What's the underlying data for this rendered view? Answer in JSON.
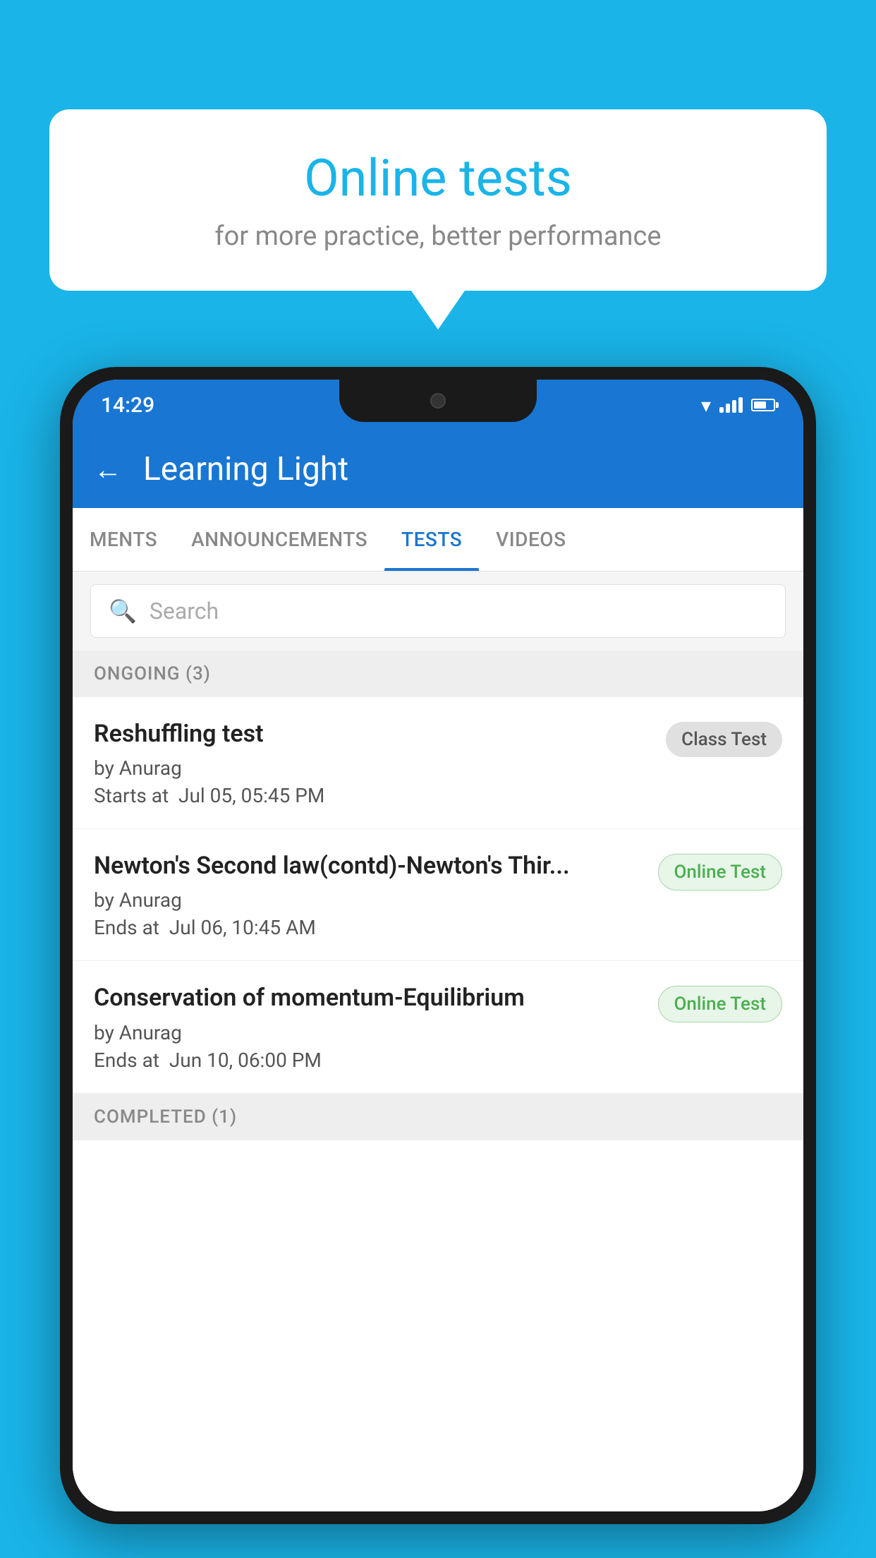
{
  "background_color": "#1ab4e8",
  "speech_bubble": {
    "title": "Online tests",
    "subtitle": "for more practice, better performance"
  },
  "status_bar": {
    "time": "14:29",
    "wifi": "▾",
    "battery_label": "battery"
  },
  "app_bar": {
    "title": "Learning Light",
    "back_icon": "←"
  },
  "tabs": [
    {
      "label": "MENTS",
      "active": false
    },
    {
      "label": "ANNOUNCEMENTS",
      "active": false
    },
    {
      "label": "TESTS",
      "active": true
    },
    {
      "label": "VIDEOS",
      "active": false
    }
  ],
  "search": {
    "placeholder": "Search"
  },
  "ongoing_section": {
    "label": "ONGOING (3)"
  },
  "tests": [
    {
      "name": "Reshuffling test",
      "author": "by Anurag",
      "time_label": "Starts at",
      "time": "Jul 05, 05:45 PM",
      "badge": "Class Test",
      "badge_type": "class"
    },
    {
      "name": "Newton's Second law(contd)-Newton's Thir...",
      "author": "by Anurag",
      "time_label": "Ends at",
      "time": "Jul 06, 10:45 AM",
      "badge": "Online Test",
      "badge_type": "online"
    },
    {
      "name": "Conservation of momentum-Equilibrium",
      "author": "by Anurag",
      "time_label": "Ends at",
      "time": "Jun 10, 06:00 PM",
      "badge": "Online Test",
      "badge_type": "online"
    }
  ],
  "completed_section": {
    "label": "COMPLETED (1)"
  }
}
